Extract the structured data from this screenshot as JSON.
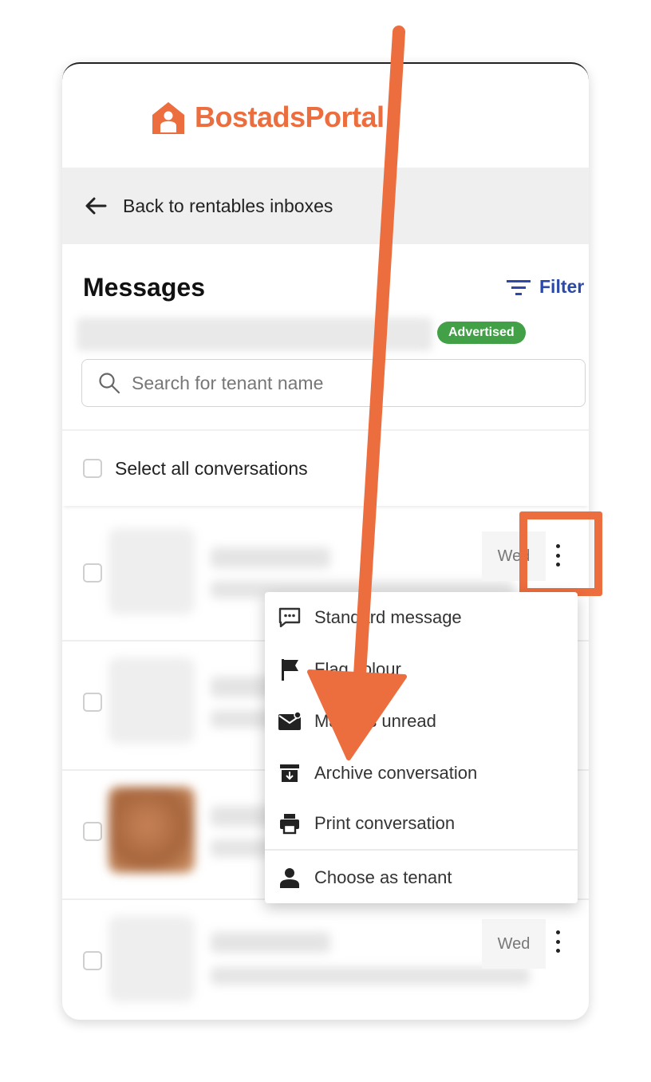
{
  "brand": {
    "name": "BostadsPortal",
    "color": "#ec6d3e"
  },
  "nav": {
    "back_label": "Back to rentables inboxes"
  },
  "page": {
    "title": "Messages",
    "filter_label": "Filter"
  },
  "listing": {
    "status_badge": "Advertised"
  },
  "search": {
    "placeholder": "Search for tenant name"
  },
  "list": {
    "select_all_label": "Select all conversations",
    "conversations": [
      {
        "date": "Wed"
      },
      {
        "date": ""
      },
      {
        "date": ""
      },
      {
        "date": "Wed"
      }
    ]
  },
  "context_menu": {
    "items": [
      {
        "label": "Standard message",
        "icon": "speech-bubble-icon"
      },
      {
        "label": "Flag colour",
        "icon": "flag-icon"
      },
      {
        "label": "Mark as unread",
        "icon": "mail-unread-icon"
      },
      {
        "label": "Archive conversation",
        "icon": "archive-icon"
      },
      {
        "label": "Print conversation",
        "icon": "printer-icon"
      },
      {
        "label": "Choose as tenant",
        "icon": "person-icon"
      }
    ]
  },
  "annotation": {
    "color": "#ec6d3e"
  }
}
